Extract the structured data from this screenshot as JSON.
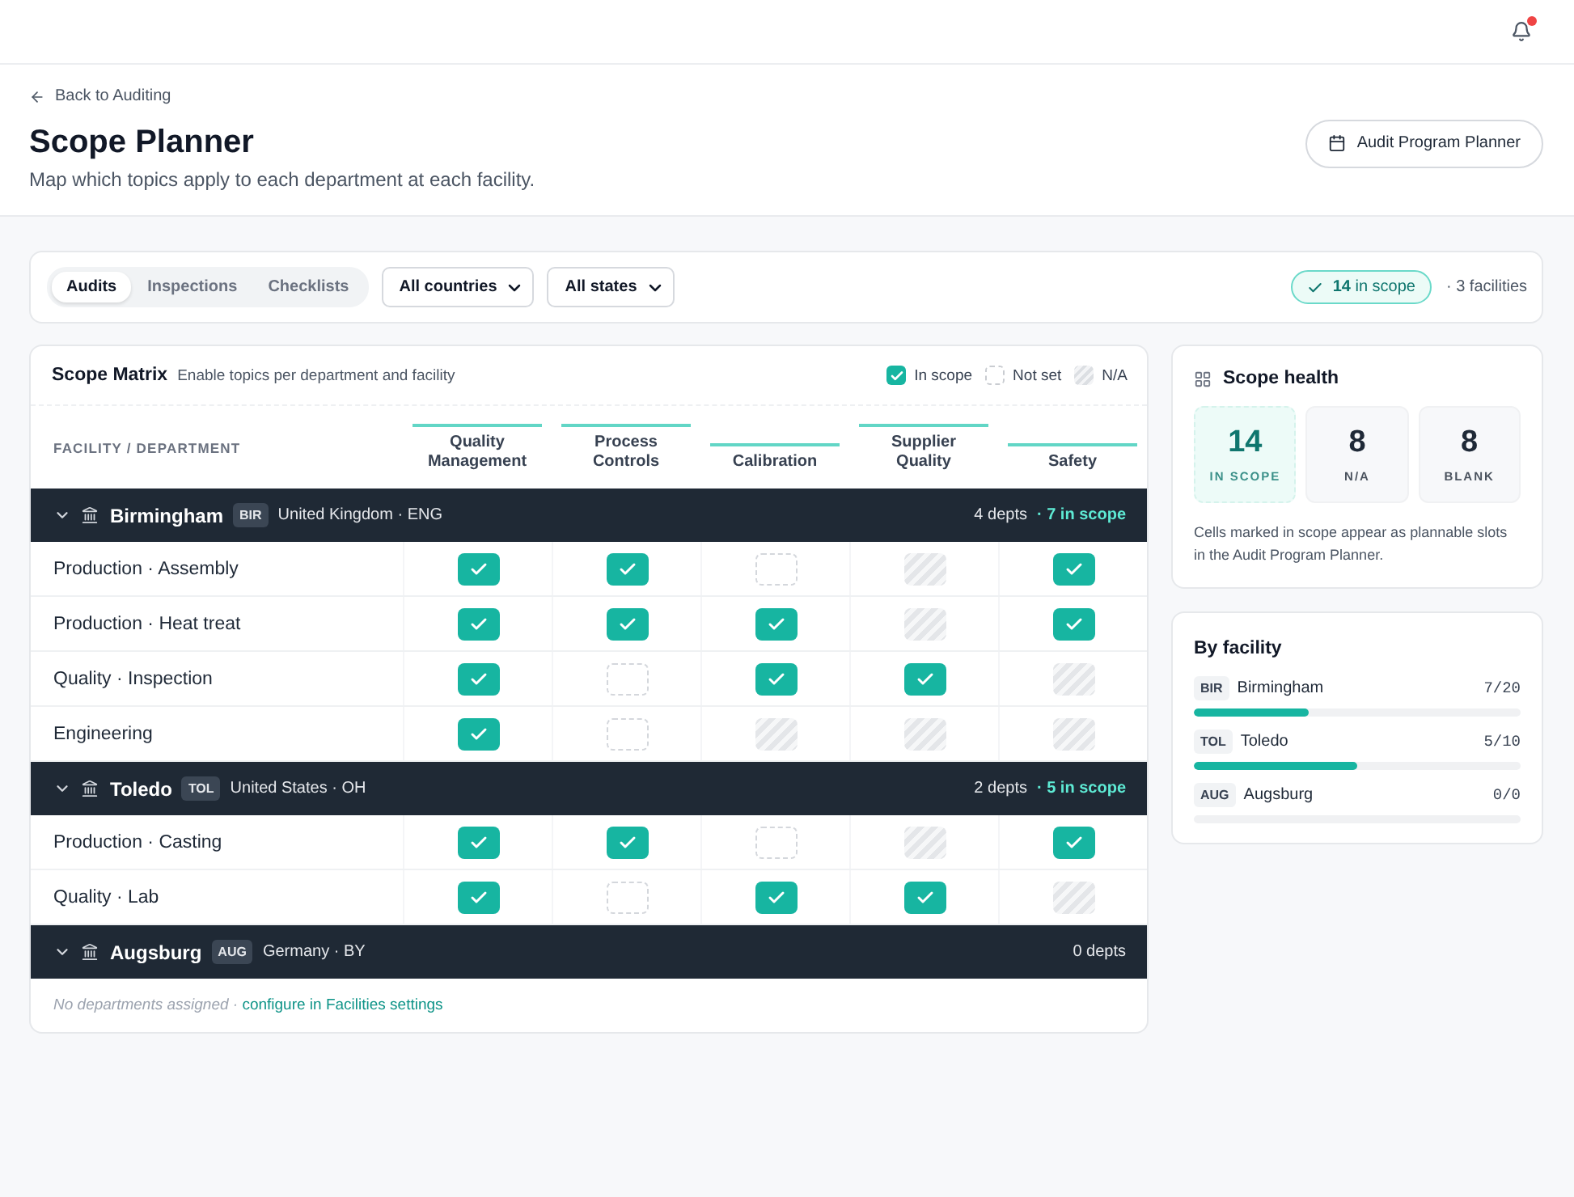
{
  "notifications": {
    "unread": true
  },
  "header": {
    "back_link": "Back to Auditing",
    "title": "Scope Planner",
    "subtitle": "Map which topics apply to each department at each facility.",
    "action_button": "Audit Program Planner"
  },
  "filters": {
    "tabs": [
      {
        "label": "Audits",
        "selected": true
      },
      {
        "label": "Inspections",
        "selected": false
      },
      {
        "label": "Checklists",
        "selected": false
      }
    ],
    "selects": [
      {
        "value": "All countries"
      },
      {
        "value": "All states"
      }
    ],
    "scope_badge": "**14** in scope",
    "facility_count": "· 3 facilities"
  },
  "matrix": {
    "title": "Scope Matrix",
    "subtitle": "Enable topics per department and facility",
    "legend": [
      {
        "kind": "in_scope",
        "label": "In scope"
      },
      {
        "kind": "not_set",
        "label": "Not set"
      },
      {
        "kind": "na",
        "label": "N/A"
      }
    ],
    "row_header": "FACILITY / DEPARTMENT",
    "columns": [
      "Quality Management",
      "Process Controls",
      "Calibration",
      "Supplier Quality",
      "Safety"
    ],
    "facilities": [
      {
        "name": "Birmingham",
        "code": "BIR",
        "location": "United Kingdom · ENG",
        "expanded": true,
        "dept_count": "4 depts",
        "scope_count": "· 7 in scope",
        "departments": [
          {
            "name": "Production · Assembly",
            "cells": [
              {
                "checked": true,
                "disabled": false
              },
              {
                "checked": true,
                "disabled": false
              },
              {
                "checked": false,
                "disabled": false
              },
              {
                "checked": false,
                "disabled": true
              },
              {
                "checked": true,
                "disabled": false
              }
            ]
          },
          {
            "name": "Production · Heat treat",
            "cells": [
              {
                "checked": true,
                "disabled": false
              },
              {
                "checked": true,
                "disabled": false
              },
              {
                "checked": true,
                "disabled": false
              },
              {
                "checked": false,
                "disabled": true
              },
              {
                "checked": true,
                "disabled": false
              }
            ]
          },
          {
            "name": "Quality · Inspection",
            "cells": [
              {
                "checked": true,
                "disabled": false
              },
              {
                "checked": false,
                "disabled": false
              },
              {
                "checked": true,
                "disabled": false
              },
              {
                "checked": true,
                "disabled": false
              },
              {
                "checked": false,
                "disabled": true
              }
            ]
          },
          {
            "name": "Engineering",
            "cells": [
              {
                "checked": true,
                "disabled": false
              },
              {
                "checked": false,
                "disabled": false
              },
              {
                "checked": false,
                "disabled": true
              },
              {
                "checked": false,
                "disabled": true
              },
              {
                "checked": false,
                "disabled": true
              }
            ]
          }
        ]
      },
      {
        "name": "Toledo",
        "code": "TOL",
        "location": "United States · OH",
        "expanded": true,
        "dept_count": "2 depts",
        "scope_count": "· 5 in scope",
        "departments": [
          {
            "name": "Production · Casting",
            "cells": [
              {
                "checked": true,
                "disabled": false
              },
              {
                "checked": true,
                "disabled": false
              },
              {
                "checked": false,
                "disabled": false
              },
              {
                "checked": false,
                "disabled": true
              },
              {
                "checked": true,
                "disabled": false
              }
            ]
          },
          {
            "name": "Quality · Lab",
            "cells": [
              {
                "checked": true,
                "disabled": false
              },
              {
                "checked": false,
                "disabled": false
              },
              {
                "checked": true,
                "disabled": false
              },
              {
                "checked": true,
                "disabled": false
              },
              {
                "checked": false,
                "disabled": true
              }
            ]
          }
        ]
      },
      {
        "name": "Augsburg",
        "code": "AUG",
        "location": "Germany · BY",
        "expanded": true,
        "dept_count": "0 depts",
        "empty_note": "No departments assigned · ",
        "empty_link": "configure in Facilities settings"
      }
    ]
  },
  "scope_health": {
    "title": "Scope health",
    "tiles": [
      {
        "kind": "in_scope",
        "value": "14",
        "label": "IN SCOPE"
      },
      {
        "kind": "na",
        "value": "8",
        "label": "N/A"
      },
      {
        "kind": "blank",
        "value": "8",
        "label": "BLANK"
      }
    ],
    "note": "Cells marked in scope appear as plannable slots in the Audit Program Planner."
  },
  "by_facility": {
    "title": "By facility",
    "rows": [
      {
        "code": "BIR",
        "name": "Birmingham",
        "reading": "7/20",
        "level": 0.35
      },
      {
        "code": "TOL",
        "name": "Toledo",
        "reading": "5/10",
        "level": 0.5
      },
      {
        "code": "AUG",
        "name": "Augsburg",
        "reading": "0/0"
      }
    ]
  }
}
